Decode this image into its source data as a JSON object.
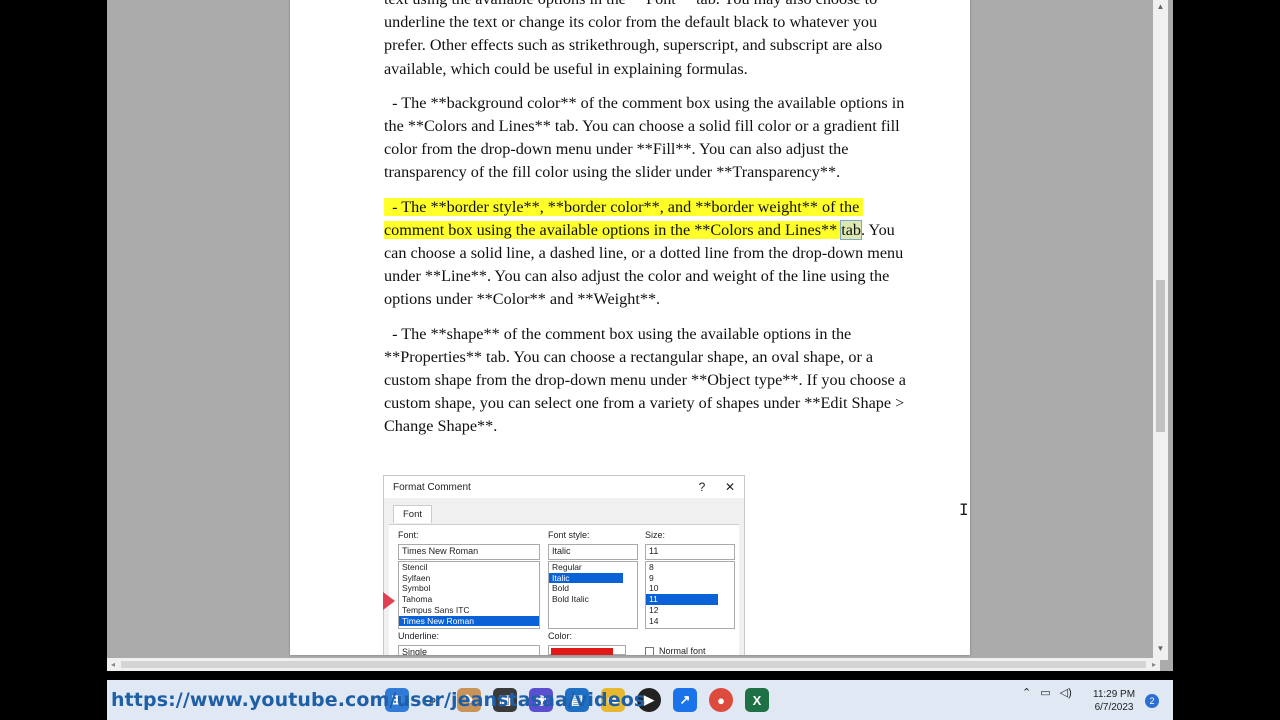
{
  "document": {
    "paragraphs": [
      {
        "text": "text using the available options in the **Font** tab. You may also choose to underline the text or change its color from the default black to whatever you prefer. Other effects such as strikethrough, superscript, and subscript are also available, which could be useful in explaining formulas."
      },
      {
        "text": "  - The **background color** of the comment box using the available options in the **Colors and Lines** tab. You can choose a solid fill color or a gradient fill color from the drop-down menu under **Fill**. You can also adjust the transparency of the fill color using the slider under **Transparency**."
      },
      {
        "highlighted": "  - The **border style**, **border color**, and **border weight** of the comment box using the available options in the **Colors and Lines** ",
        "tab_word": "tab",
        "rest": ". You can choose a solid line, a dashed line, or a dotted line from the drop-down menu under **Line**. You can also adjust the color and weight of the line using the options under **Color** and **Weight**."
      },
      {
        "text": "  - The **shape** of the comment box using the available options in the **Properties** tab. You can choose a rectangular shape, an oval shape, or a custom shape from the drop-down menu under **Object type**. If you choose a custom shape, you can select one from a variety of shapes under **Edit Shape > Change Shape**."
      }
    ]
  },
  "dialog": {
    "title": "Format Comment",
    "help": "?",
    "close": "✕",
    "tab": "Font",
    "font_label": "Font:",
    "font_value": "Times New Roman",
    "font_list": [
      "Stencil",
      "Sylfaen",
      "Symbol",
      "Tahoma",
      "Tempus Sans ITC",
      "Times New Roman"
    ],
    "style_label": "Font style:",
    "style_value": "Italic",
    "style_list": [
      "Regular",
      "Italic",
      "Bold",
      "Bold Italic"
    ],
    "size_label": "Size:",
    "size_value": "11",
    "size_list": [
      "8",
      "9",
      "10",
      "11",
      "12",
      "14"
    ],
    "underline_label": "Underline:",
    "underline_value": "Single",
    "color_label": "Color:",
    "normal_font_label": "Normal font"
  },
  "taskbar": {
    "url_overlay": "https://www.youtube.com/user/jeanstasaa/videos",
    "clock_time": "11:29 PM",
    "clock_date": "6/7/2023",
    "notification_count": "2"
  },
  "colors": {
    "highlight": "#ffff2a",
    "url": "#1f5fa8"
  }
}
